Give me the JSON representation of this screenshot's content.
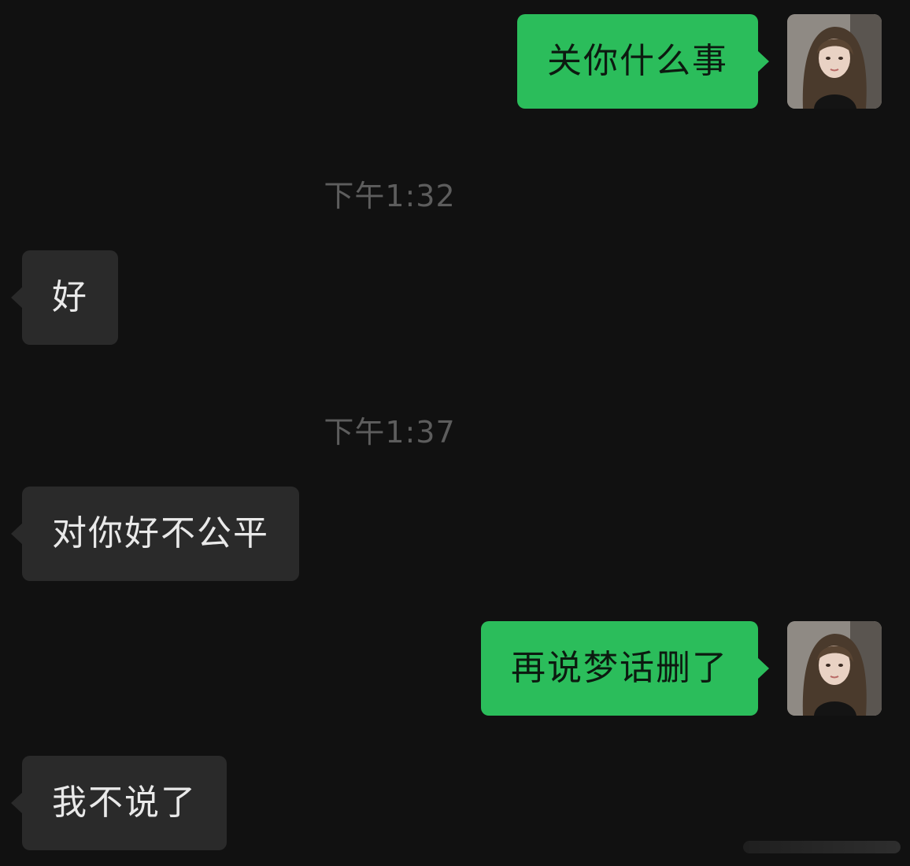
{
  "messages": [
    {
      "text": "关你什么事"
    },
    {
      "text": "好"
    },
    {
      "text": "对你好不公平"
    },
    {
      "text": "再说梦话删了"
    },
    {
      "text": "我不说了"
    }
  ],
  "timestamps": [
    {
      "text": "下午1:32"
    },
    {
      "text": "下午1:37"
    }
  ],
  "colors": {
    "background": "#111111",
    "outgoing_bubble": "#2bbd5b",
    "incoming_bubble": "#2a2a2a",
    "timestamp": "#5d5d5d"
  }
}
